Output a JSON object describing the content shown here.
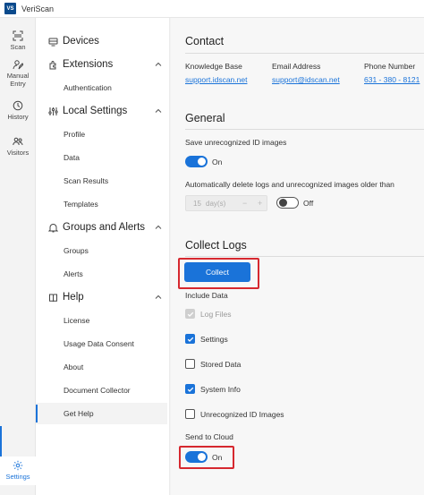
{
  "app": {
    "logo_text": "VS",
    "title": "VeriScan"
  },
  "rail": [
    {
      "label": "Scan",
      "icon": "scan-icon"
    },
    {
      "label": "Manual Entry",
      "icon": "manual-entry-icon"
    },
    {
      "label": "History",
      "icon": "history-icon"
    },
    {
      "label": "Visitors",
      "icon": "visitors-icon"
    },
    {
      "label": "Settings",
      "icon": "gear-icon",
      "active": true
    }
  ],
  "nav": {
    "groups": [
      {
        "label": "Devices",
        "icon": "devices-icon",
        "expandable": false,
        "items": []
      },
      {
        "label": "Extensions",
        "icon": "extensions-icon",
        "expandable": true,
        "items": [
          "Authentication"
        ]
      },
      {
        "label": "Local Settings",
        "icon": "local-settings-icon",
        "expandable": true,
        "items": [
          "Profile",
          "Data",
          "Scan Results",
          "Templates"
        ]
      },
      {
        "label": "Groups and Alerts",
        "icon": "groups-alerts-icon",
        "expandable": true,
        "items": [
          "Groups",
          "Alerts"
        ]
      },
      {
        "label": "Help",
        "icon": "help-icon",
        "expandable": true,
        "items": [
          "License",
          "Usage Data Consent",
          "About",
          "Document Collector",
          "Get Help"
        ]
      }
    ],
    "active_item": "Get Help"
  },
  "contact": {
    "title": "Contact",
    "kb_label": "Knowledge Base",
    "kb_value": "support.idscan.net",
    "email_label": "Email Address",
    "email_value": "support@idscan.net",
    "phone_label": "Phone Number",
    "phone_value": "631 - 380 - 8121"
  },
  "general": {
    "title": "General",
    "save_label": "Save unrecognized ID images",
    "save_toggle": "On",
    "auto_delete_label": "Automatically delete logs and unrecognized images older than",
    "stepper_value": "15",
    "stepper_unit": "day(s)",
    "stepper_minus": "−",
    "stepper_plus": "+",
    "auto_delete_toggle": "Off"
  },
  "collect_logs": {
    "title": "Collect Logs",
    "button_label": "Collect",
    "include_label": "Include Data",
    "items": [
      {
        "label": "Log Files",
        "state": "disabled"
      },
      {
        "label": "Settings",
        "state": "checked"
      },
      {
        "label": "Stored Data",
        "state": "unchecked"
      },
      {
        "label": "System Info",
        "state": "checked"
      },
      {
        "label": "Unrecognized ID Images",
        "state": "unchecked"
      }
    ],
    "send_label": "Send to Cloud",
    "send_toggle": "On"
  },
  "colors": {
    "accent": "#1a73d9",
    "highlight": "#d6282f"
  }
}
